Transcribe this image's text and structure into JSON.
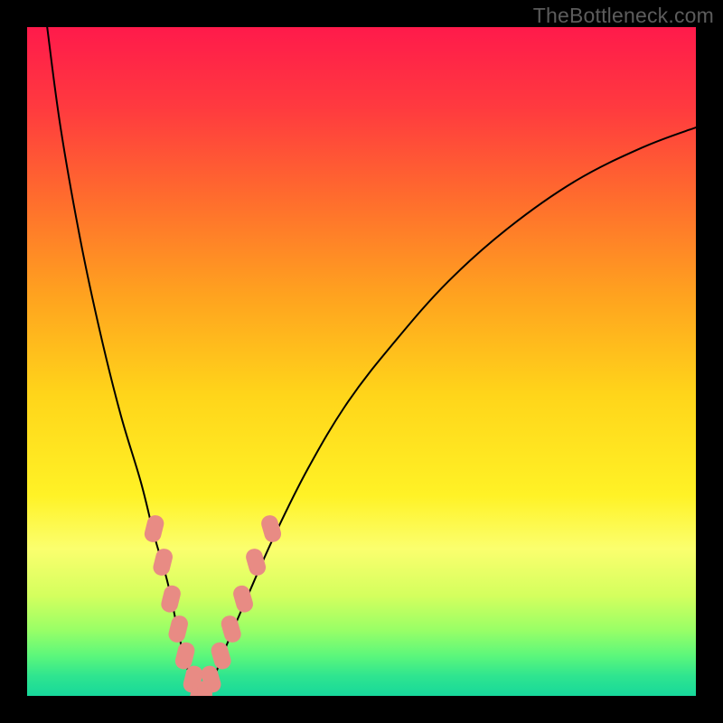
{
  "watermark": "TheBottleneck.com",
  "chart_data": {
    "type": "line",
    "title": "",
    "xlabel": "",
    "ylabel": "",
    "xlim": [
      0,
      100
    ],
    "ylim": [
      0,
      100
    ],
    "grid": false,
    "legend": false,
    "background": {
      "type": "vertical-gradient",
      "stops": [
        {
          "pos": 0.0,
          "color": "#ff1a4b"
        },
        {
          "pos": 0.12,
          "color": "#ff3a3f"
        },
        {
          "pos": 0.25,
          "color": "#ff6a2e"
        },
        {
          "pos": 0.4,
          "color": "#ffa21f"
        },
        {
          "pos": 0.55,
          "color": "#ffd51a"
        },
        {
          "pos": 0.7,
          "color": "#fff226"
        },
        {
          "pos": 0.78,
          "color": "#fbff6e"
        },
        {
          "pos": 0.85,
          "color": "#d4ff5e"
        },
        {
          "pos": 0.9,
          "color": "#9bff66"
        },
        {
          "pos": 0.94,
          "color": "#5cf77b"
        },
        {
          "pos": 0.97,
          "color": "#2fe58f"
        },
        {
          "pos": 1.0,
          "color": "#17d89b"
        }
      ]
    },
    "series": [
      {
        "name": "bottleneck-curve",
        "color": "#000000",
        "width": 2,
        "x": [
          3,
          5,
          8,
          11,
          14,
          17,
          19,
          21,
          22.5,
          24,
          26,
          28,
          30,
          33,
          37,
          42,
          48,
          55,
          63,
          72,
          82,
          92,
          100
        ],
        "y": [
          100,
          85,
          68,
          54,
          42,
          32,
          24,
          17,
          10,
          4,
          0,
          3,
          8,
          15,
          24,
          34,
          44,
          53,
          62,
          70,
          77,
          82,
          85
        ]
      }
    ],
    "markers": [
      {
        "name": "left-branch-beads",
        "color": "#e88b84",
        "size": 30,
        "shape": "rect-rounded",
        "points": [
          {
            "x": 19.0,
            "y": 25
          },
          {
            "x": 20.3,
            "y": 20
          },
          {
            "x": 21.5,
            "y": 14.5
          },
          {
            "x": 22.6,
            "y": 10
          },
          {
            "x": 23.6,
            "y": 6
          },
          {
            "x": 24.8,
            "y": 2.5
          }
        ]
      },
      {
        "name": "right-branch-beads",
        "color": "#e88b84",
        "size": 30,
        "shape": "rect-rounded",
        "points": [
          {
            "x": 27.5,
            "y": 2.5
          },
          {
            "x": 29.0,
            "y": 6
          },
          {
            "x": 30.5,
            "y": 10
          },
          {
            "x": 32.3,
            "y": 14.5
          },
          {
            "x": 34.2,
            "y": 20
          },
          {
            "x": 36.5,
            "y": 25
          }
        ]
      },
      {
        "name": "trough-beads",
        "color": "#e88b84",
        "size": 26,
        "shape": "rect-rounded",
        "points": [
          {
            "x": 25.6,
            "y": 0.5
          },
          {
            "x": 26.6,
            "y": 0.5
          }
        ]
      }
    ]
  }
}
